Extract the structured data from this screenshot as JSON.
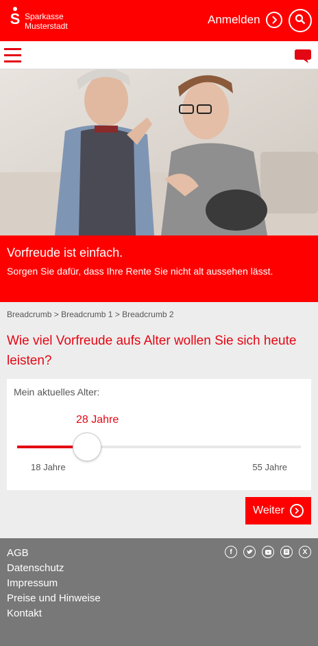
{
  "header": {
    "brand_line1": "Sparkasse",
    "brand_line2": "Musterstadt",
    "login_label": "Anmelden",
    "search_icon": "search-icon"
  },
  "nav": {
    "menu_icon": "hamburger-menu-icon",
    "chat_icon": "chat-bubble-icon"
  },
  "banner": {
    "title": "Vorfreude ist einfach.",
    "subtitle": "Sorgen Sie dafür, dass Ihre Rente Sie nicht alt aussehen lässt."
  },
  "breadcrumb": {
    "items": [
      "Breadcrumb",
      "Breadcrumb 1",
      "Breadcrumb 2"
    ],
    "separator": ">"
  },
  "question": "Wie viel Vorfreude aufs Alter wollen Sie sich heute leisten?",
  "age_slider": {
    "label": "Mein aktuelles Alter:",
    "current_label": "28 Jahre",
    "value": 28,
    "min": 18,
    "max": 55,
    "min_label": "18 Jahre",
    "max_label": "55 Jahre"
  },
  "next_button": {
    "label": "Weiter"
  },
  "footer": {
    "links": [
      "AGB",
      "Datenschutz",
      "Impressum",
      "Preise und Hinweise",
      "Kontakt"
    ],
    "social_icons": [
      "facebook-icon",
      "twitter-icon",
      "youtube-icon",
      "app-icon",
      "xing-icon"
    ]
  },
  "colors": {
    "brand_red": "#ff0000",
    "accent_red": "#e30613",
    "footer_grey": "#787878",
    "page_bg": "#ededed"
  }
}
